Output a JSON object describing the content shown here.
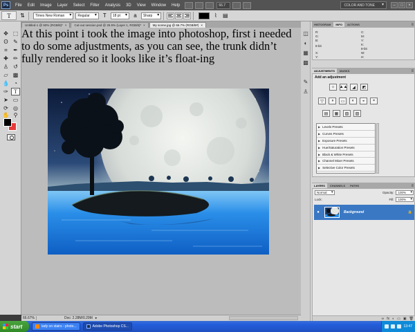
{
  "menubar": {
    "logo": "Ps",
    "items": [
      "File",
      "Edit",
      "Image",
      "Layer",
      "Select",
      "Filter",
      "Analysis",
      "3D",
      "View",
      "Window",
      "Help"
    ],
    "zoom": "66.7",
    "workspace": "COLOR AND TONE",
    "win_buttons": [
      "–",
      "□",
      "×"
    ]
  },
  "options": {
    "tool_glyph": "T",
    "font_family": "Times New Roman",
    "font_style": "Regular",
    "font_size": "18 pt",
    "antialias": "Sharp",
    "text_color": "#000000"
  },
  "doc_tabs": [
    {
      "label": "Untitled-1 @ 50% (RGB/8)*",
      "close": "×"
    },
    {
      "label": "Cut-out session.psd @ 25.5% (Layer 1, RGB/8)*",
      "close": "×"
    },
    {
      "label": "My scene.jpg @ 66.7% (RGB/8#)",
      "close": "×"
    }
  ],
  "annotation_text": "At this point i took the image into photoshop, first i needed to do some adjustments, as you can see, the trunk didn’t fully rendered so it looks like it’s float-ing",
  "status": {
    "zoom": "66.67%",
    "doc": "Doc: 2.28M/0.29M",
    "arrow": "▸"
  },
  "panels": {
    "top_tabs": [
      "HISTOGRAM",
      "INFO",
      "ACTIONS"
    ],
    "info": {
      "r": "R:",
      "g": "G:",
      "b": "B:",
      "c": "C:",
      "m": "M:",
      "y": "Y:",
      "k": "K:",
      "bit_left": "8-bit",
      "bit_right": "8-bit",
      "x": "X:",
      "yc": "Y:",
      "w": "W:",
      "h": "H:"
    },
    "adj_tabs": [
      "ADJUSTMENTS",
      "MASKS"
    ],
    "adj_title": "Add an adjustment",
    "adj_icons_row1": [
      "☼",
      "▲▲",
      "◢",
      "◩"
    ],
    "adj_icons_row2": [
      "▽",
      "◑",
      "▭",
      "◐",
      "◒",
      "◓"
    ],
    "adj_icons_row3": [
      "▤",
      "▦",
      "▧",
      "▨"
    ],
    "presets": [
      "Levels Presets",
      "Curves Presets",
      "Exposure Presets",
      "Hue/Saturation Presets",
      "Black & White Presets",
      "Channel Mixer Presets",
      "Selective Color Presets"
    ],
    "layers_tabs": [
      "LAYERS",
      "CHANNELS",
      "PATHS"
    ],
    "layers": {
      "blend": "Normal",
      "opacity_label": "Opacity:",
      "opacity": "100%",
      "lock_label": "Lock:",
      "fill_label": "Fill:",
      "fill": "100%",
      "layer_name": "Background",
      "eye": "●",
      "lock_icon": "🔒",
      "footer": [
        "∞",
        "fx",
        "◐",
        "▭",
        "▣",
        "🗑"
      ]
    }
  },
  "taskbar": {
    "start": "start",
    "tasks": [
      {
        "label": "lady on stairs - photo...",
        "active": false
      },
      {
        "label": "Adobe Photoshop CS...",
        "active": true
      }
    ],
    "clock": "13:47"
  }
}
